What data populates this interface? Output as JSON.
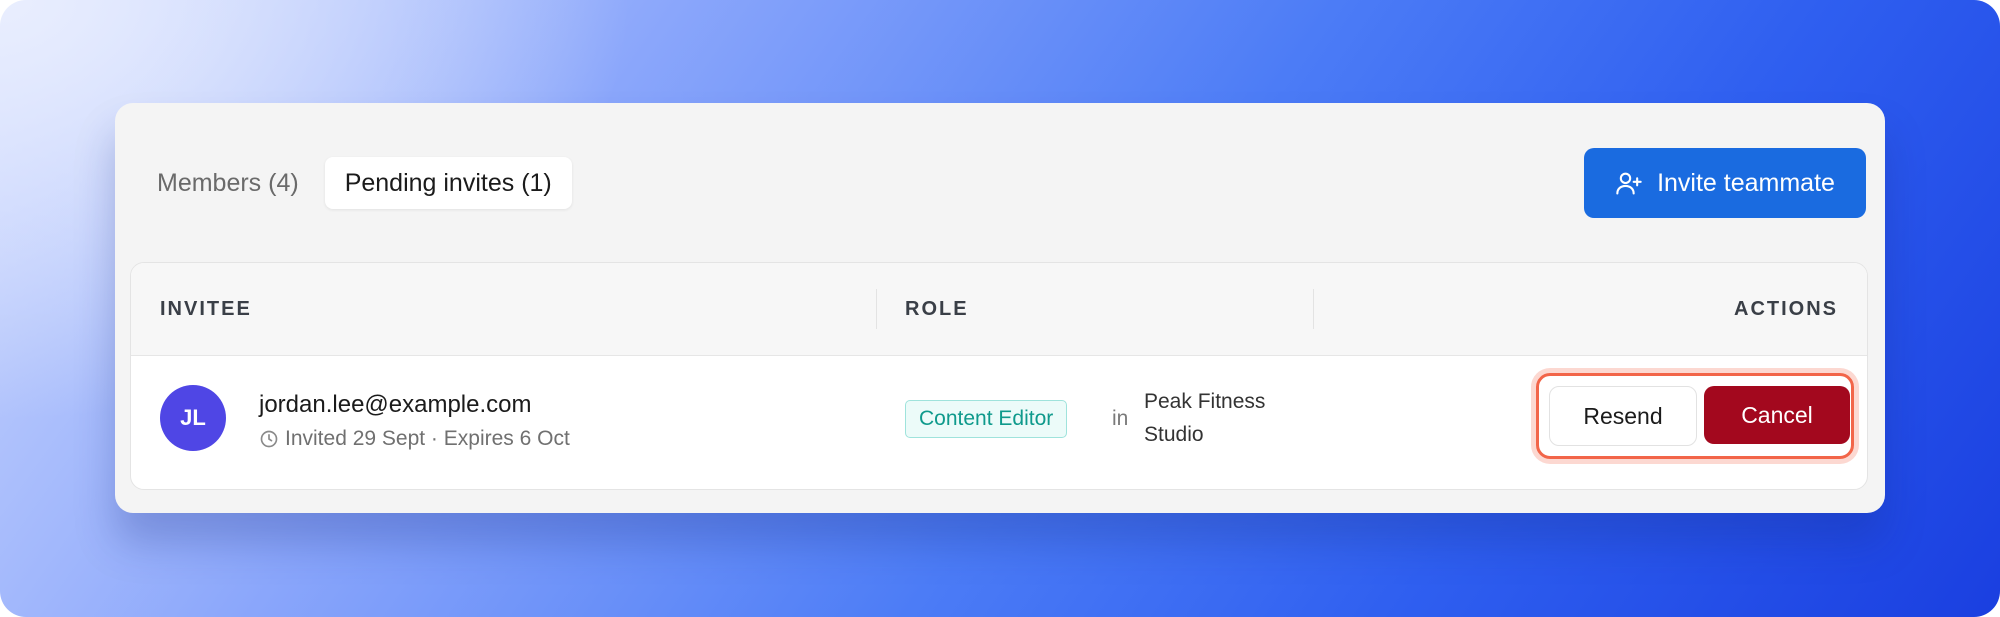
{
  "tabs": [
    {
      "label": "Members (4)",
      "active": false
    },
    {
      "label": "Pending invites (1)",
      "active": true
    }
  ],
  "invite_button": {
    "label": "Invite teammate",
    "icon": "user-plus-icon"
  },
  "table": {
    "headers": {
      "invitee": "INVITEE",
      "role": "ROLE",
      "actions": "ACTIONS"
    },
    "rows": [
      {
        "initials": "JL",
        "email": "jordan.lee@example.com",
        "meta": "Invited 29 Sept · Expires 6 Oct",
        "meta_icon": "clock-icon",
        "role": "Content Editor",
        "in_word": "in",
        "org": "Peak Fitness Studio",
        "actions": {
          "resend": "Resend",
          "cancel": "Cancel"
        }
      }
    ]
  },
  "colors": {
    "primary": "#1a6be0",
    "danger": "#a3081e",
    "avatar": "#4f46e5",
    "role_badge": "#0f9a8c",
    "highlight": "#f26549"
  }
}
